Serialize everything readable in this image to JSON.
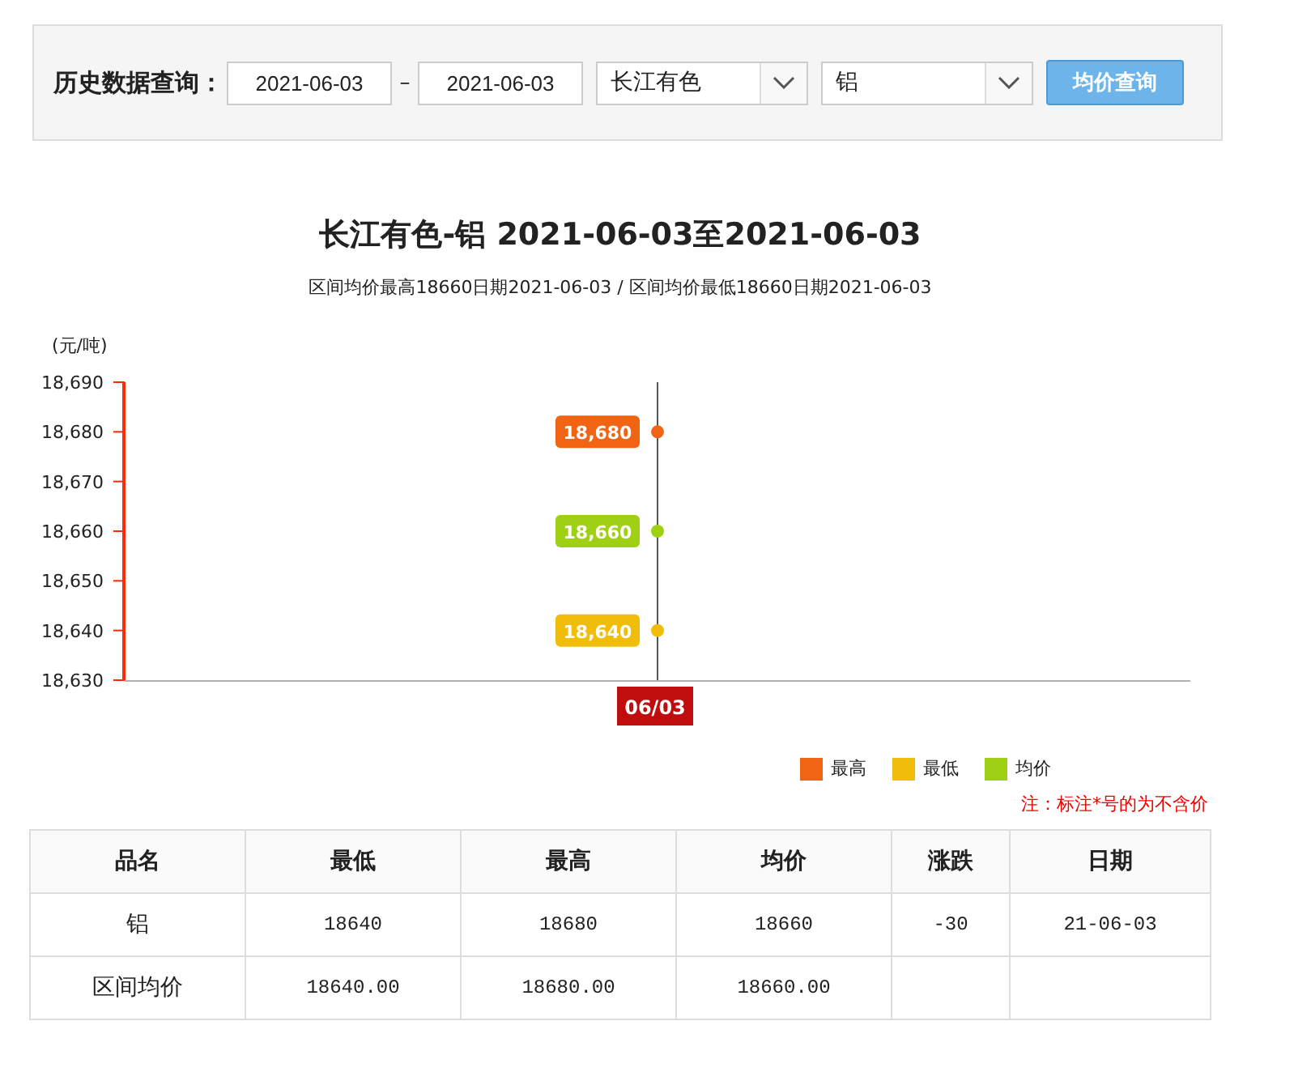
{
  "query": {
    "label": "历史数据查询：",
    "date_from": "2021-06-03",
    "separator": "–",
    "date_to": "2021-06-03",
    "market": "长江有色",
    "metal": "铝",
    "button": "均价查询"
  },
  "title": "长江有色-铝 2021-06-03至2021-06-03",
  "subtitle": "区间均价最高18660日期2021-06-03 / 区间均价最低18660日期2021-06-03",
  "chart": {
    "unit": "(元/吨)",
    "chart_data": {
      "type": "scatter",
      "categories": [
        "06/03"
      ],
      "ylim": [
        18630,
        18690
      ],
      "yticks": [
        {
          "value": 18630,
          "label": "18,630"
        },
        {
          "value": 18640,
          "label": "18,640"
        },
        {
          "value": 18650,
          "label": "18,650"
        },
        {
          "value": 18660,
          "label": "18,660"
        },
        {
          "value": 18670,
          "label": "18,670"
        },
        {
          "value": 18680,
          "label": "18,680"
        },
        {
          "value": 18690,
          "label": "18,690"
        }
      ],
      "series": [
        {
          "name": "最高",
          "color": "#f06414",
          "values": [
            18680
          ],
          "value_labels": [
            "18,680"
          ]
        },
        {
          "name": "最低",
          "color": "#f0be0a",
          "values": [
            18640
          ],
          "value_labels": [
            "18,640"
          ]
        },
        {
          "name": "均价",
          "color": "#a0d014",
          "values": [
            18660
          ],
          "value_labels": [
            "18,660"
          ]
        }
      ],
      "data_labels": true,
      "ref_lines": [
        {
          "axis": "x",
          "value": "06/03"
        }
      ]
    }
  },
  "note": "注：标注*号的为不含价",
  "table": {
    "columns": [
      "品名",
      "最低",
      "最高",
      "均价",
      "涨跌",
      "日期"
    ],
    "rows": [
      [
        "铝",
        "18640",
        "18680",
        "18660",
        "-30",
        "21-06-03"
      ],
      [
        "区间均价",
        "18640.00",
        "18680.00",
        "18660.00",
        "",
        ""
      ]
    ]
  }
}
